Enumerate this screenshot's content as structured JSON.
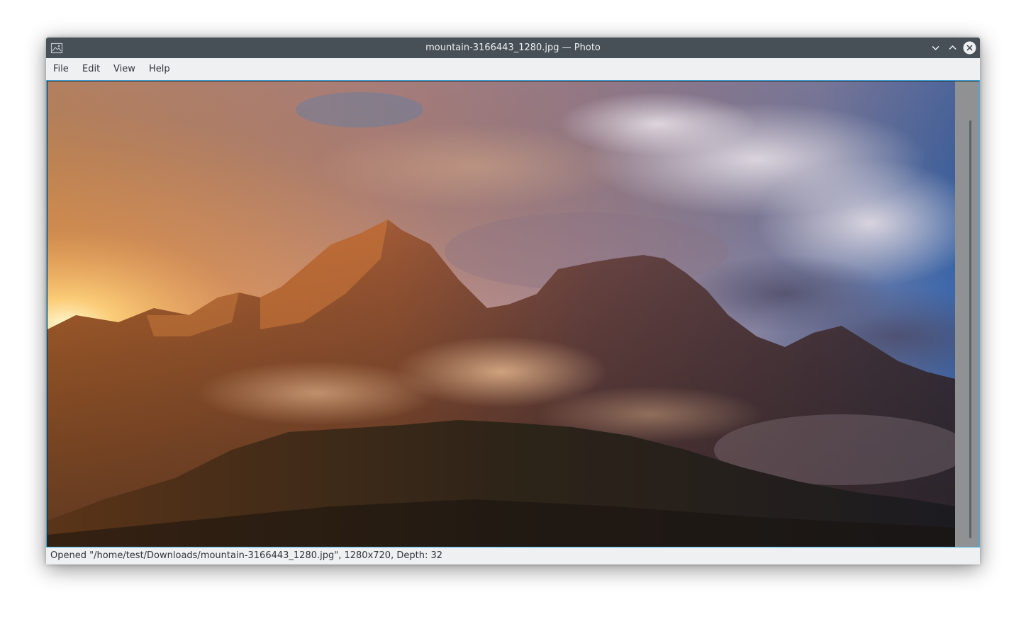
{
  "window": {
    "title": "mountain-3166443_1280.jpg — Photo",
    "app_icon": "image-icon",
    "controls": [
      "minimize-icon",
      "maximize-icon",
      "close-icon"
    ]
  },
  "menubar": {
    "items": [
      {
        "label": "File"
      },
      {
        "label": "Edit"
      },
      {
        "label": "View"
      },
      {
        "label": "Help"
      }
    ]
  },
  "image": {
    "description_icon": "photo-canvas"
  },
  "statusbar": {
    "text": "Opened \"/home/test/Downloads/mountain-3166443_1280.jpg\", 1280x720, Depth: 32"
  },
  "colors": {
    "titlebar": "#475057",
    "window_bg": "#eff0f1",
    "focus_accent": "#3daee9"
  }
}
